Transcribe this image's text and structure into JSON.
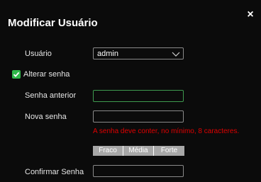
{
  "dialog": {
    "title": "Modificar Usuário",
    "close_symbol": "×"
  },
  "form": {
    "user_label": "Usuário",
    "user_value": "admin",
    "change_password_label": "Alterar senha",
    "change_password_checked": true,
    "old_password_label": "Senha anterior",
    "new_password_label": "Nova senha",
    "error_message": "A senha deve conter, no mínimo, 8 caracteres.",
    "strength": [
      "Fraco",
      "Média",
      "Forte"
    ],
    "confirm_password_label": "Confirmar Senha"
  },
  "colors": {
    "accent": "#2fb84a",
    "error": "#e00000",
    "strength_bar": "#a8a8a8"
  },
  "icons": {
    "close": "close-icon",
    "dropdown": "chevron-down-icon",
    "checkbox": "checkmark-icon"
  }
}
